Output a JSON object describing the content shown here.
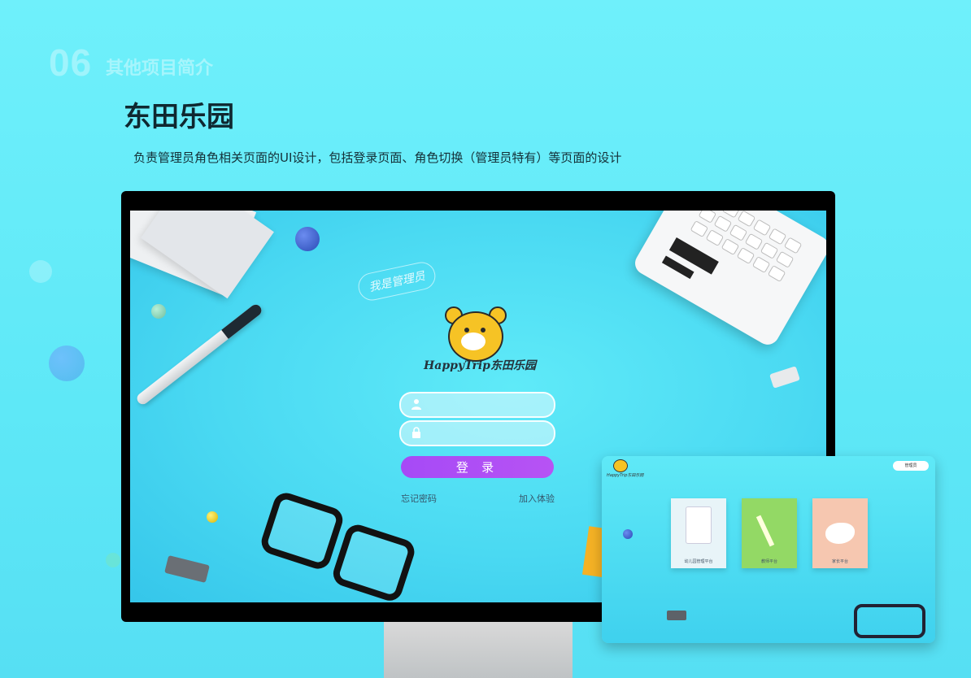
{
  "section": {
    "number": "06",
    "title": "其他项目简介"
  },
  "project": {
    "title": "东田乐园",
    "description": "负责管理员角色相关页面的UI设计，包括登录页面、角色切换（管理员特有）等页面的设计"
  },
  "login": {
    "brand": "HappyTrip东田乐园",
    "username_placeholder": "",
    "password_placeholder": "",
    "login_button": "登 录",
    "forgot_password": "忘记密码",
    "join_trial": "加入体验",
    "handwritten_note": "我是管理员"
  },
  "role_switch": {
    "brand": "HappyTrip东田乐园",
    "user_label": "管理员",
    "tiles": [
      {
        "label": "幼儿园管理平台",
        "color": "#e8f4f8"
      },
      {
        "label": "教师平台",
        "color": "#93d965"
      },
      {
        "label": "家长平台",
        "color": "#f6c7b0"
      }
    ]
  },
  "colors": {
    "accent": "#b050f5",
    "background": "#5ee8f7",
    "text_dark": "#0f2830"
  },
  "icons": [
    "user-icon",
    "lock-icon",
    "bear-logo-icon"
  ]
}
